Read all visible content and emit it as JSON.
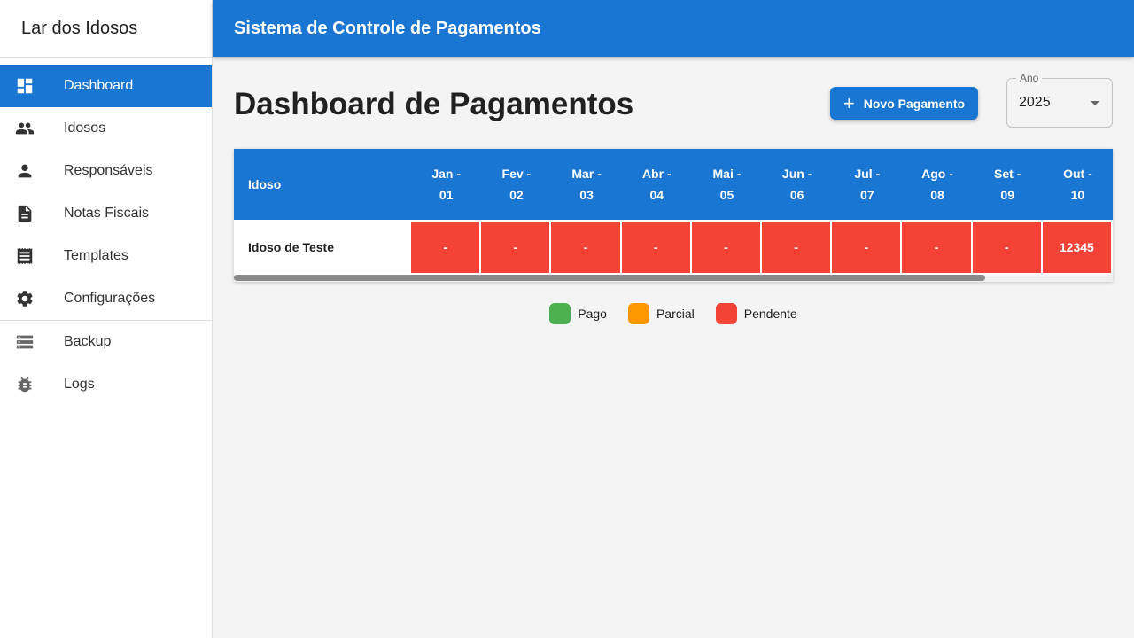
{
  "sidebar": {
    "brand": "Lar dos Idosos",
    "items": [
      {
        "label": "Dashboard",
        "icon": "dashboard-icon",
        "active": true
      },
      {
        "label": "Idosos",
        "icon": "people-icon"
      },
      {
        "label": "Responsáveis",
        "icon": "person-icon"
      },
      {
        "label": "Notas Fiscais",
        "icon": "document-icon"
      },
      {
        "label": "Templates",
        "icon": "receipt-icon"
      },
      {
        "label": "Configurações",
        "icon": "gear-icon"
      }
    ],
    "secondary_items": [
      {
        "label": "Backup",
        "icon": "storage-icon"
      },
      {
        "label": "Logs",
        "icon": "bug-icon"
      }
    ]
  },
  "appbar": {
    "title": "Sistema de Controle de Pagamentos"
  },
  "page": {
    "title": "Dashboard de Pagamentos",
    "new_button_label": "Novo Pagamento",
    "year_label": "Ano",
    "year_value": "2025"
  },
  "table": {
    "header_idoso": "Idoso",
    "months": [
      {
        "l1": "Jan -",
        "l2": "01"
      },
      {
        "l1": "Fev -",
        "l2": "02"
      },
      {
        "l1": "Mar -",
        "l2": "03"
      },
      {
        "l1": "Abr -",
        "l2": "04"
      },
      {
        "l1": "Mai -",
        "l2": "05"
      },
      {
        "l1": "Jun -",
        "l2": "06"
      },
      {
        "l1": "Jul -",
        "l2": "07"
      },
      {
        "l1": "Ago -",
        "l2": "08"
      },
      {
        "l1": "Set -",
        "l2": "09"
      },
      {
        "l1": "Out -",
        "l2": "10"
      }
    ],
    "rows": [
      {
        "name": "Idoso de Teste",
        "cells": [
          {
            "value": "-",
            "status": "pendente"
          },
          {
            "value": "-",
            "status": "pendente"
          },
          {
            "value": "-",
            "status": "pendente"
          },
          {
            "value": "-",
            "status": "pendente"
          },
          {
            "value": "-",
            "status": "pendente"
          },
          {
            "value": "-",
            "status": "pendente"
          },
          {
            "value": "-",
            "status": "pendente"
          },
          {
            "value": "-",
            "status": "pendente"
          },
          {
            "value": "-",
            "status": "pendente"
          },
          {
            "value": "12345",
            "status": "pendente"
          }
        ]
      }
    ]
  },
  "legend": [
    {
      "label": "Pago",
      "color": "#4caf50"
    },
    {
      "label": "Parcial",
      "color": "#ff9800"
    },
    {
      "label": "Pendente",
      "color": "#f44336"
    }
  ],
  "colors": {
    "primary": "#1976d2",
    "pendente": "#f44336",
    "pago": "#4caf50",
    "parcial": "#ff9800"
  }
}
